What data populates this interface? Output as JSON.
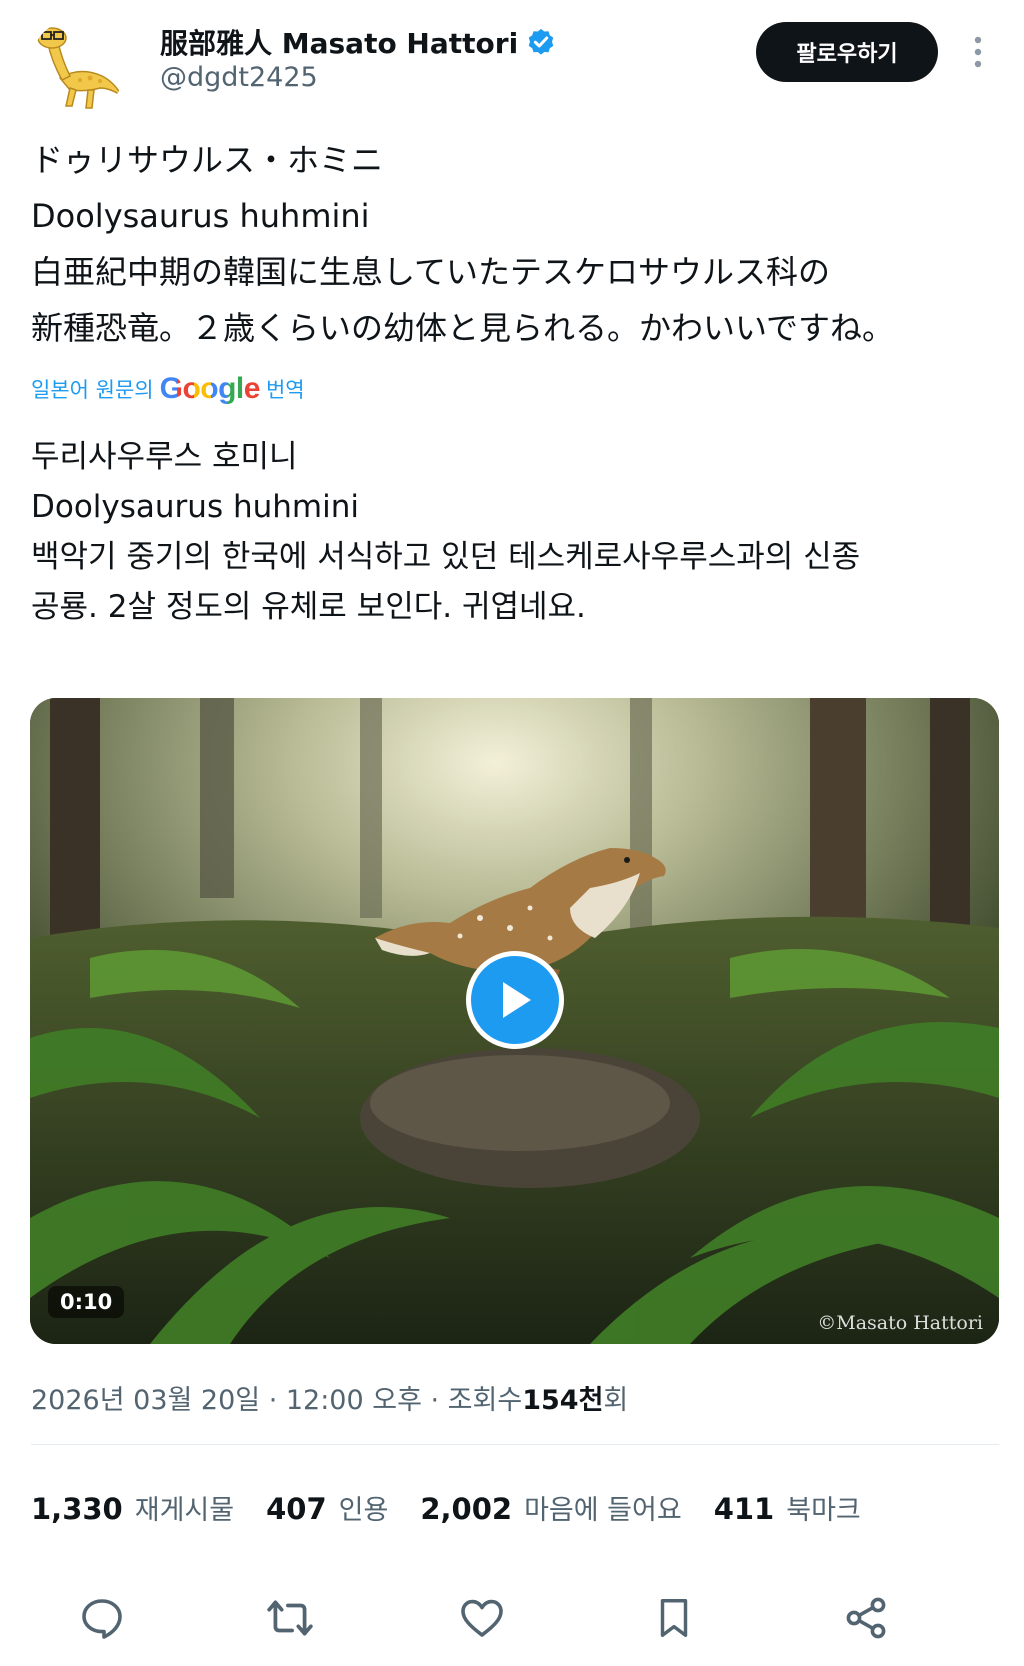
{
  "author": {
    "display_name": "服部雅人 Masato Hattori",
    "handle": "@dgdt2425",
    "verified": true,
    "avatar_icon": "yellow-dinosaur-avatar-icon"
  },
  "header": {
    "follow_label": "팔로우하기",
    "more_icon": "more-vertical-icon"
  },
  "post": {
    "original_lines": [
      "ドゥリサウルス・ホミニ",
      "Doolysaurus huhmini",
      "白亜紀中期の韓国に生息していたテスケロサウルス科の",
      "新種恐竜。２歳くらいの幼体と見られる。かわいいですね。"
    ],
    "translate": {
      "prefix": "일본어 원문의",
      "brand": "Google",
      "suffix": "번역"
    },
    "translated_lines": [
      "두리사우루스 호미니",
      "Doolysaurus huhmini",
      "백악기 중기의 한국에 서식하고 있던 테스케로사우루스과의 신종",
      "공룡. 2살 정도의 유체로 보인다. 귀엽네요."
    ]
  },
  "media": {
    "duration": "0:10",
    "watermark": "©Masato Hattori",
    "play_icon": "play-icon"
  },
  "meta": {
    "date_time": "2026년 03월 20일 · 12:00 오후 · 조회수 ",
    "views_count": "154천",
    "views_suffix": "회"
  },
  "stats": {
    "reposts": {
      "count": "1,330",
      "label": "재게시물"
    },
    "quotes": {
      "count": "407",
      "label": "인용"
    },
    "likes": {
      "count": "2,002",
      "label": "마음에 들어요"
    },
    "bookmarks": {
      "count": "411",
      "label": "북마크"
    }
  },
  "actions": {
    "reply_icon": "reply-icon",
    "repost_icon": "repost-icon",
    "like_icon": "heart-icon",
    "bookmark_icon": "bookmark-icon",
    "share_icon": "share-icon"
  },
  "colors": {
    "accent": "#1d9bf0",
    "text_primary": "#0f1419",
    "text_secondary": "#536471",
    "follow_bg": "#0f1419"
  }
}
